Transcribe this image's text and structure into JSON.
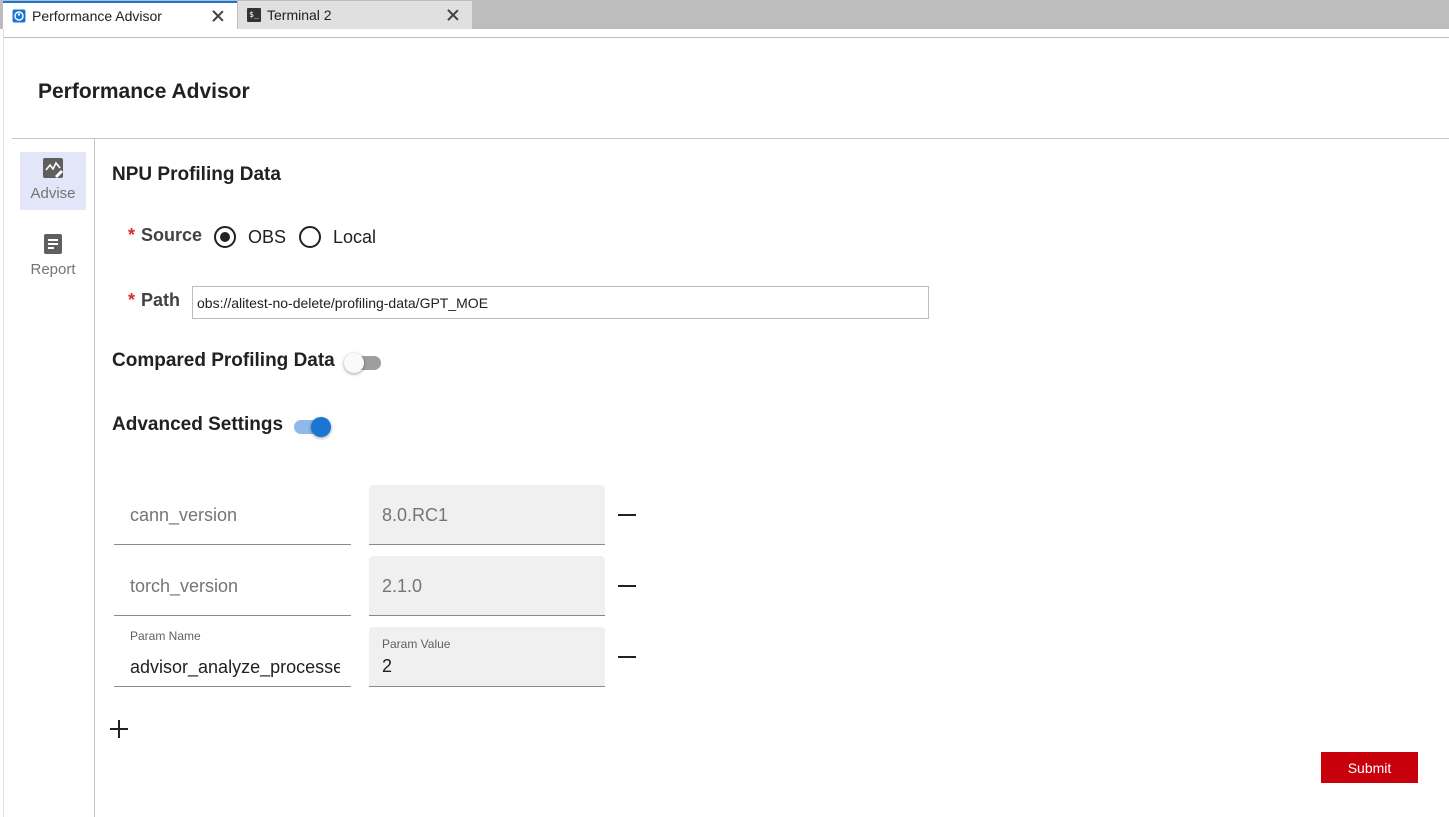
{
  "tabs": [
    {
      "label": "Performance Advisor",
      "icon": "advisor-icon",
      "active": true
    },
    {
      "label": "Terminal 2",
      "icon": "terminal-icon",
      "active": false
    }
  ],
  "app": {
    "title": "Performance Advisor"
  },
  "sidebar": {
    "items": [
      {
        "label": "Advise",
        "icon": "chart-icon",
        "selected": true
      },
      {
        "label": "Report",
        "icon": "document-icon",
        "selected": false
      }
    ]
  },
  "form": {
    "npu_title": "NPU Profiling Data",
    "required_mark": "*",
    "source_label": "Source",
    "source_options": [
      {
        "label": "OBS",
        "checked": true
      },
      {
        "label": "Local",
        "checked": false
      }
    ],
    "path_label": "Path",
    "path_value": "obs://alitest-no-delete/profiling-data/GPT_MOE",
    "compared_label": "Compared Profiling Data",
    "compared_enabled": false,
    "advanced_label": "Advanced Settings",
    "advanced_enabled": true,
    "params": [
      {
        "name": "cann_version",
        "value": "8.0.RC1"
      },
      {
        "name": "torch_version",
        "value": "2.1.0"
      },
      {
        "name_label": "Param Name",
        "name": "advisor_analyze_processes",
        "value_label": "Param Value",
        "value": "2"
      }
    ],
    "submit_label": "Submit"
  },
  "colors": {
    "accent": "#1976d2",
    "submit": "#c7000b",
    "required": "#d32f2f",
    "selected_nav": "#e3e5f8"
  }
}
